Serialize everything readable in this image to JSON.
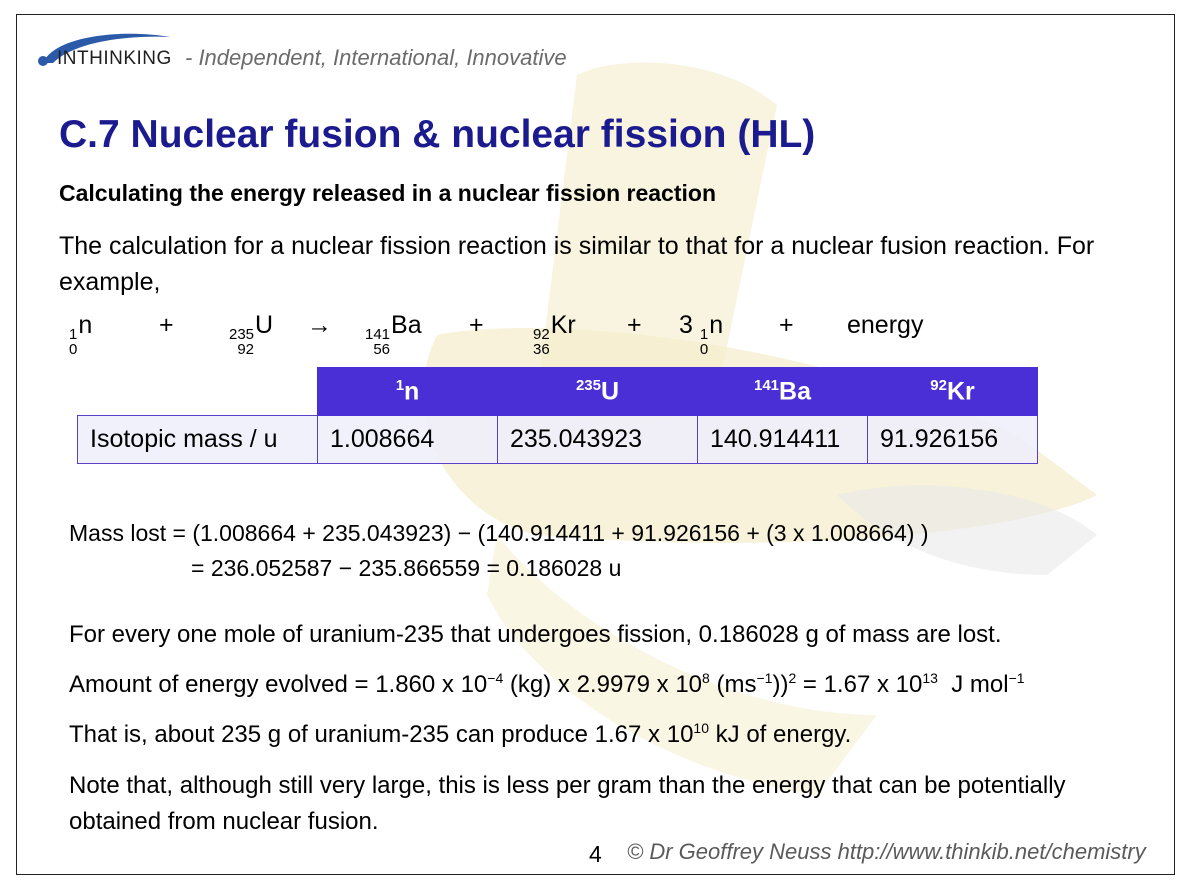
{
  "header": {
    "logo_text": "INTHINKING",
    "tagline": "- Independent, International, Innovative"
  },
  "title": "C.7 Nuclear fusion & nuclear fission (HL)",
  "subtitle": "Calculating the energy released in a nuclear fission reaction",
  "intro": "The calculation for a nuclear fission reaction is similar to that for a nuclear fusion reaction. For example,",
  "equation": {
    "n": {
      "mass": "1",
      "atomic": "0",
      "symbol": "n"
    },
    "u": {
      "mass": "235",
      "atomic": "92",
      "symbol": "U"
    },
    "ba": {
      "mass": "141",
      "atomic": "56",
      "symbol": "Ba"
    },
    "kr": {
      "mass": "92",
      "atomic": "36",
      "symbol": "Kr"
    },
    "coef": "3",
    "plus": "+",
    "arrow": "→",
    "energy": "energy"
  },
  "table": {
    "headers": [
      {
        "sup": "1",
        "sym": "n"
      },
      {
        "sup": "235",
        "sym": "U"
      },
      {
        "sup": "141",
        "sym": "Ba"
      },
      {
        "sup": "92",
        "sym": "Kr"
      }
    ],
    "row_label": "Isotopic mass / u",
    "values": [
      "1.008664",
      "235.043923",
      "140.914411",
      "91.926156"
    ]
  },
  "calc": {
    "line1": "Mass lost = (1.008664 + 235.043923) − (140.914411 + 91.926156 + (3 x 1.008664) )",
    "line2": "= 236.052587 − 235.866559 = 0.186028 u"
  },
  "mole_line": "For every one mole of uranium-235 that undergoes fission, 0.186028 g of mass are lost.",
  "energy_line": {
    "a": "Amount of energy evolved = 1.860 x 10",
    "a_exp": "−4",
    "b": " (kg) x 2.9979 x 10",
    "b_exp": "8",
    "c": " (ms",
    "c_exp": "−1",
    "d": "))",
    "d_exp": "2",
    "e": " = 1.67 x 10",
    "e_exp": "13",
    "f": "  J mol",
    "f_exp": "−1"
  },
  "produce_line": {
    "a": "That is, about 235 g of uranium-235 can produce 1.67 x 10",
    "exp": "10",
    "b": " kJ of energy."
  },
  "note": "Note that, although still very large, this is less per gram than the energy that can be potentially obtained from nuclear fusion.",
  "footer": {
    "page": "4",
    "copyright": "© Dr Geoffrey Neuss http://www.thinkib.net/chemistry"
  },
  "colors": {
    "title": "#1b1b8f",
    "table_header": "#4a2fd6",
    "watermark": "#f6efcf"
  }
}
